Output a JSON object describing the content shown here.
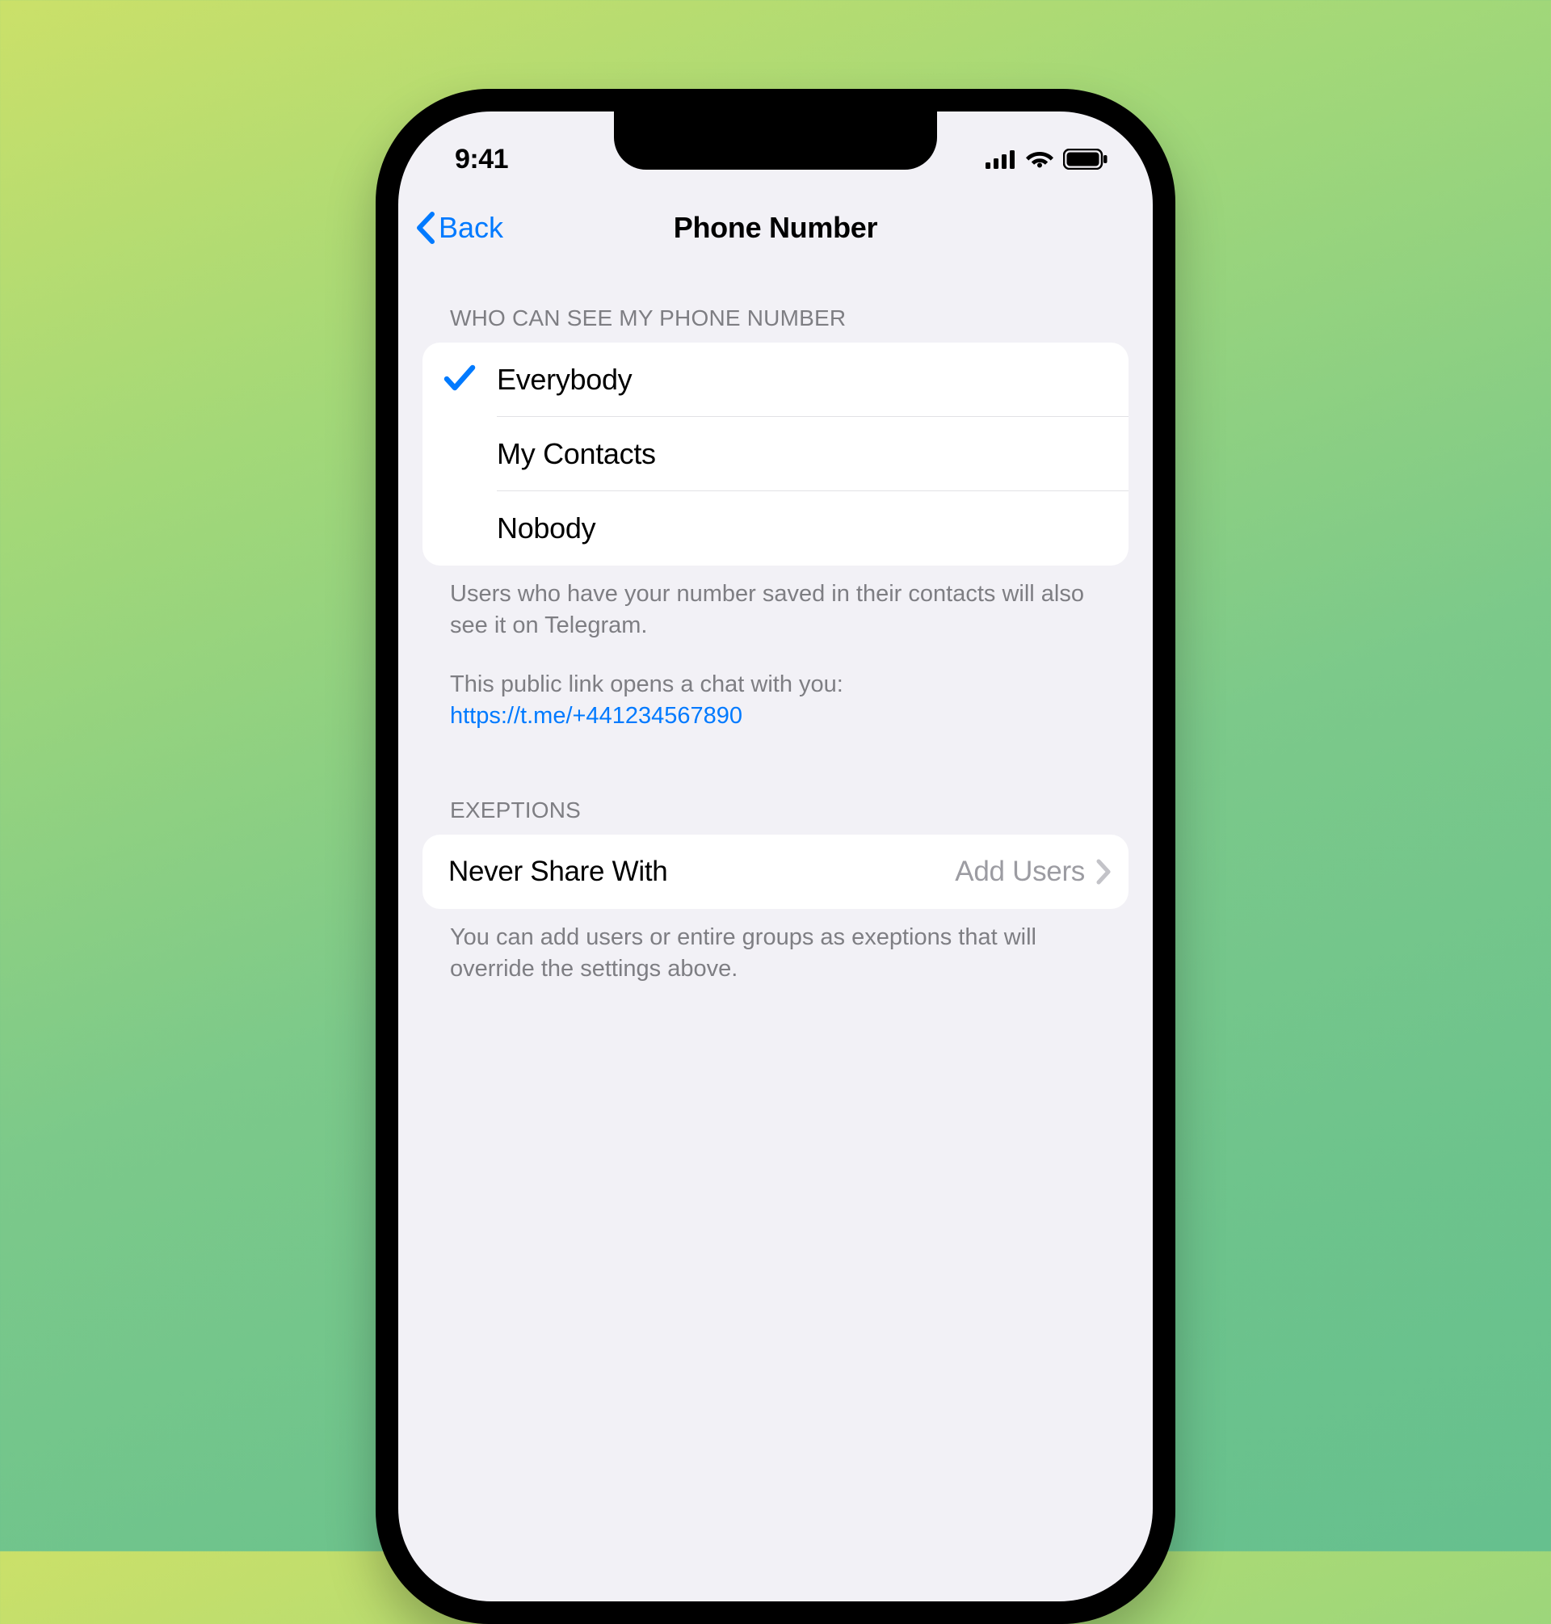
{
  "statusBar": {
    "time": "9:41"
  },
  "nav": {
    "back": "Back",
    "title": "Phone Number"
  },
  "section1": {
    "header": "WHO CAN SEE MY PHONE NUMBER",
    "options": [
      {
        "label": "Everybody",
        "selected": true
      },
      {
        "label": "My Contacts",
        "selected": false
      },
      {
        "label": "Nobody",
        "selected": false
      }
    ],
    "footer1": "Users who have your number saved in their contacts will also see it on Telegram.",
    "footer2": "This public link opens a chat with you:",
    "link": "https://t.me/+441234567890"
  },
  "section2": {
    "header": "EXEPTIONS",
    "row": {
      "label": "Never Share With",
      "value": "Add Users"
    },
    "footer": "You can add users or entire groups as exeptions that will override the settings above."
  }
}
